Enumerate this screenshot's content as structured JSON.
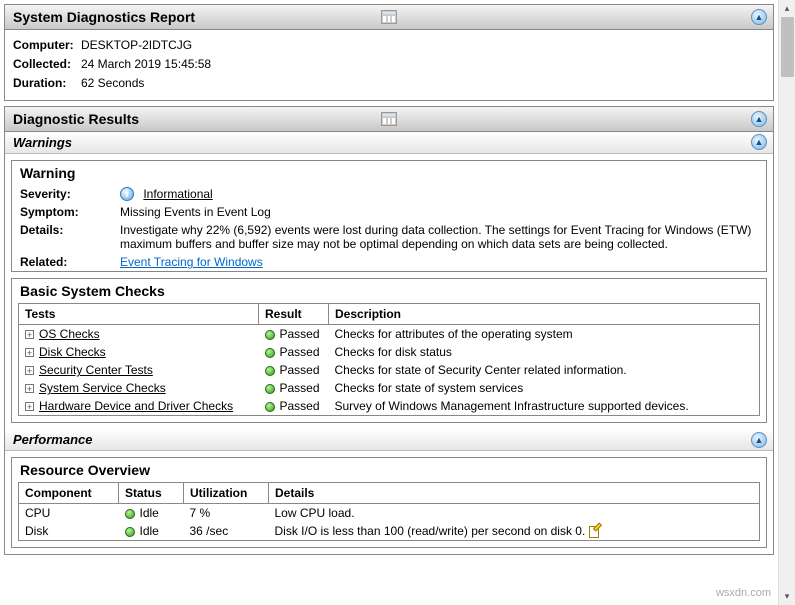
{
  "report": {
    "title": "System Diagnostics Report",
    "meta": {
      "computer_label": "Computer:",
      "computer_value": "DESKTOP-2IDTCJG",
      "collected_label": "Collected:",
      "collected_value": "24 March 2019 15:45:58",
      "duration_label": "Duration:",
      "duration_value": "62 Seconds"
    }
  },
  "diagnostic": {
    "title": "Diagnostic Results",
    "warnings_header": "Warnings",
    "warning_box": {
      "title": "Warning",
      "severity_label": "Severity:",
      "severity_value": "Informational",
      "symptom_label": "Symptom:",
      "symptom_value": "Missing Events in Event Log",
      "details_label": "Details:",
      "details_value": "Investigate why 22% (6,592) events were lost during data collection. The settings for Event Tracing for Windows (ETW) maximum buffers and buffer size may not be optimal depending on which data sets are being collected.",
      "related_label": "Related:",
      "related_link": "Event Tracing for Windows"
    },
    "basic_checks": {
      "title": "Basic System Checks",
      "headers": {
        "tests": "Tests",
        "result": "Result",
        "description": "Description"
      },
      "rows": [
        {
          "tests": "OS Checks",
          "result": "Passed",
          "description": "Checks for attributes of the operating system"
        },
        {
          "tests": "Disk Checks",
          "result": "Passed",
          "description": "Checks for disk status"
        },
        {
          "tests": "Security Center Tests",
          "result": "Passed",
          "description": "Checks for state of Security Center related information."
        },
        {
          "tests": "System Service Checks",
          "result": "Passed",
          "description": "Checks for state of system services"
        },
        {
          "tests": "Hardware Device and Driver Checks",
          "result": "Passed",
          "description": "Survey of Windows Management Infrastructure supported devices."
        }
      ]
    },
    "performance_header": "Performance",
    "resource_overview": {
      "title": "Resource Overview",
      "headers": {
        "component": "Component",
        "status": "Status",
        "utilization": "Utilization",
        "details": "Details"
      },
      "rows": [
        {
          "component": "CPU",
          "status": "Idle",
          "utilization": "7 %",
          "details": "Low CPU load."
        },
        {
          "component": "Disk",
          "status": "Idle",
          "utilization": "36 /sec",
          "details": "Disk I/O is less than 100 (read/write) per second on disk 0."
        }
      ]
    }
  },
  "watermark": "wsxdn.com"
}
